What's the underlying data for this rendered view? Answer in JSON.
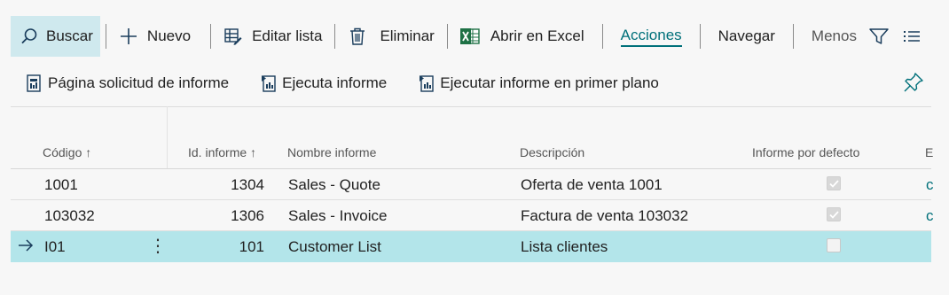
{
  "toolbar": {
    "search": "Buscar",
    "new": "Nuevo",
    "edit_list": "Editar lista",
    "delete": "Eliminar",
    "open_excel": "Abrir en Excel",
    "actions": "Acciones",
    "navigate": "Navegar",
    "less": "Menos"
  },
  "reports": {
    "request_page": "Página solicitud de informe",
    "run_report": "Ejecuta informe",
    "run_foreground": "Ejecutar informe en primer plano"
  },
  "table": {
    "headers": {
      "code": "Código",
      "report_id": "Id. informe",
      "report_name": "Nombre informe",
      "description": "Descripción",
      "default_report": "Informe por defecto",
      "e_col": "E"
    },
    "rows": [
      {
        "code": "1001",
        "report_id": "1304",
        "report_name": "Sales - Quote",
        "description": "Oferta de venta 1001",
        "default": true,
        "e": "c"
      },
      {
        "code": "103032",
        "report_id": "1306",
        "report_name": "Sales - Invoice",
        "description": "Factura de venta 103032",
        "default": true,
        "e": "c"
      },
      {
        "code": "I01",
        "report_id": "101",
        "report_name": "Customer List",
        "description": "Lista clientes",
        "default": false,
        "e": ""
      }
    ]
  },
  "colors": {
    "accent": "#00707a",
    "selected_row": "#b3e5ea",
    "search_bg": "#cfe9ee",
    "excel_green": "#1e7145"
  }
}
